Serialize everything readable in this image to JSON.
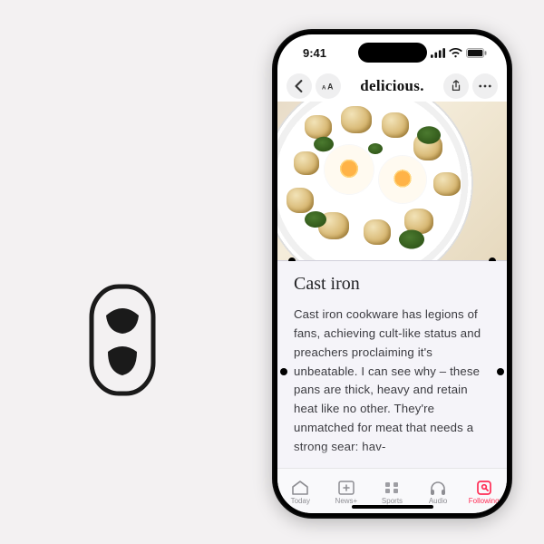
{
  "status": {
    "time": "9:41"
  },
  "nav": {
    "title": "delicious."
  },
  "article": {
    "headline": "Cast iron",
    "body": "Cast iron cookware has legions of fans, achieving cult-like status and preachers proclaiming it's unbeatable. I can see why – these pans are thick, heavy and retain heat like no other. They're unmatched for meat that needs a strong sear: hav-"
  },
  "tabs": {
    "today": "Today",
    "newsplus": "News+",
    "sports": "Sports",
    "audio": "Audio",
    "following": "Following"
  }
}
